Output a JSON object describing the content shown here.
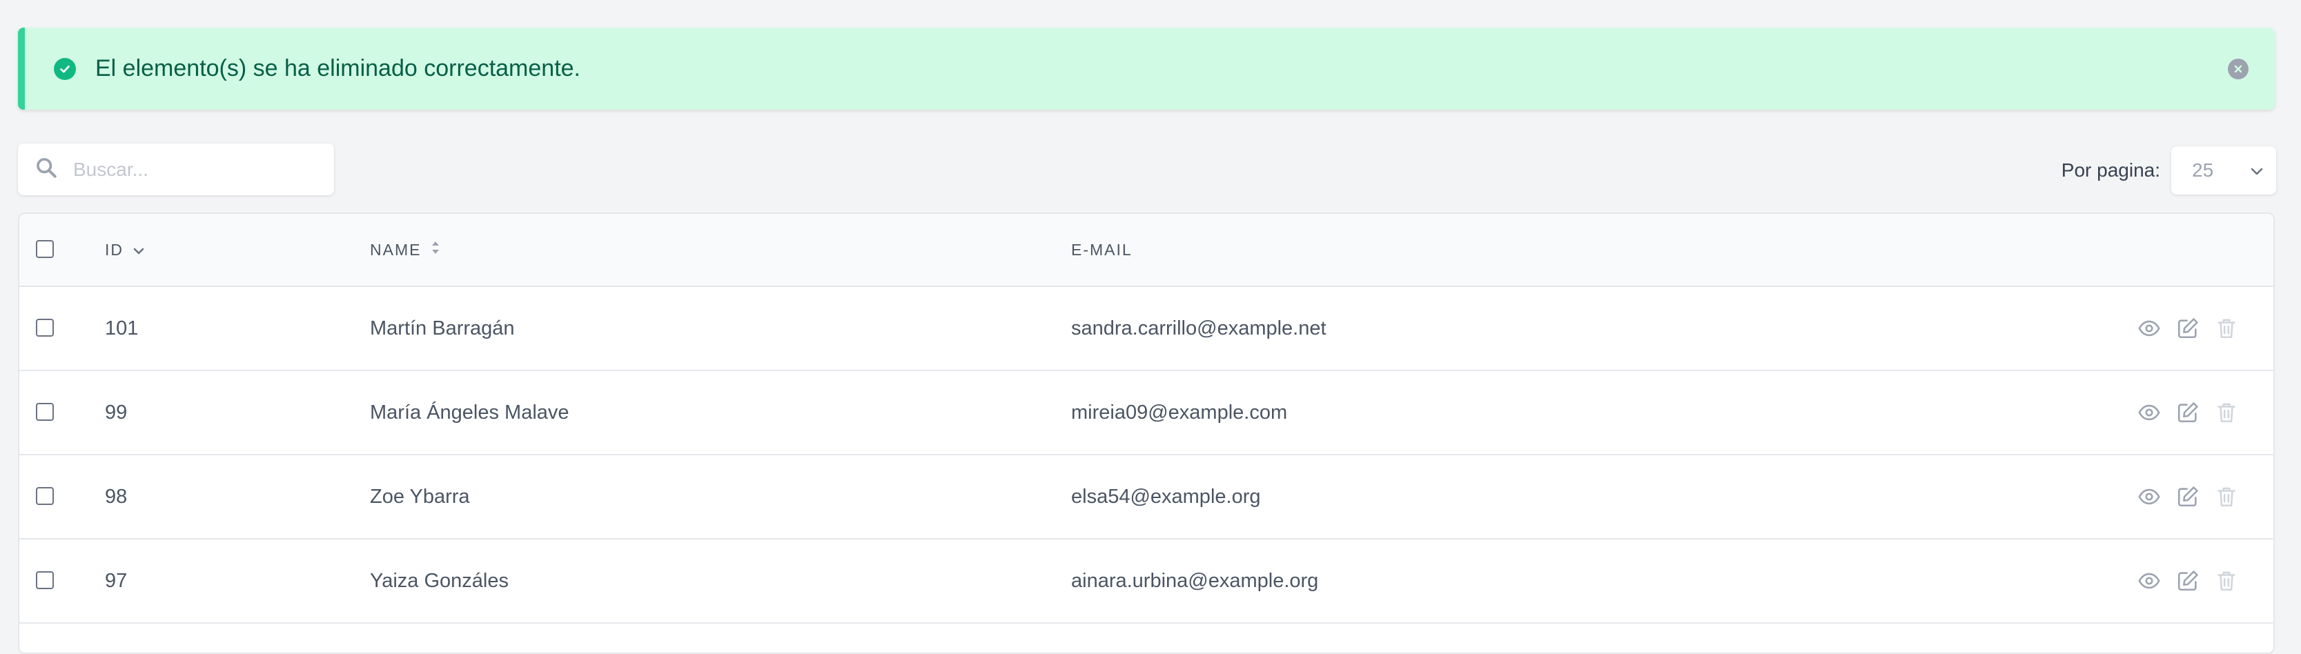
{
  "alert": {
    "message": "El elemento(s) se ha eliminado correctamente.",
    "icon": "check-circle-icon",
    "close_icon": "close-circle-icon",
    "color_bg": "#d1fae5",
    "color_accent": "#34d399"
  },
  "search": {
    "placeholder": "Buscar...",
    "value": ""
  },
  "per_page": {
    "label": "Por pagina:",
    "value": "25"
  },
  "table": {
    "columns": {
      "id": "ID",
      "name": "NAME",
      "email": "E-MAIL"
    },
    "rows": [
      {
        "id": "101",
        "name": "Martín Barragán",
        "email": "sandra.carrillo@example.net"
      },
      {
        "id": "99",
        "name": "María Ángeles Malave",
        "email": "mireia09@example.com"
      },
      {
        "id": "98",
        "name": "Zoe Ybarra",
        "email": "elsa54@example.org"
      },
      {
        "id": "97",
        "name": "Yaiza Gonzáles",
        "email": "ainara.urbina@example.org"
      }
    ],
    "row_actions": [
      "view-icon",
      "edit-icon",
      "delete-icon"
    ]
  }
}
